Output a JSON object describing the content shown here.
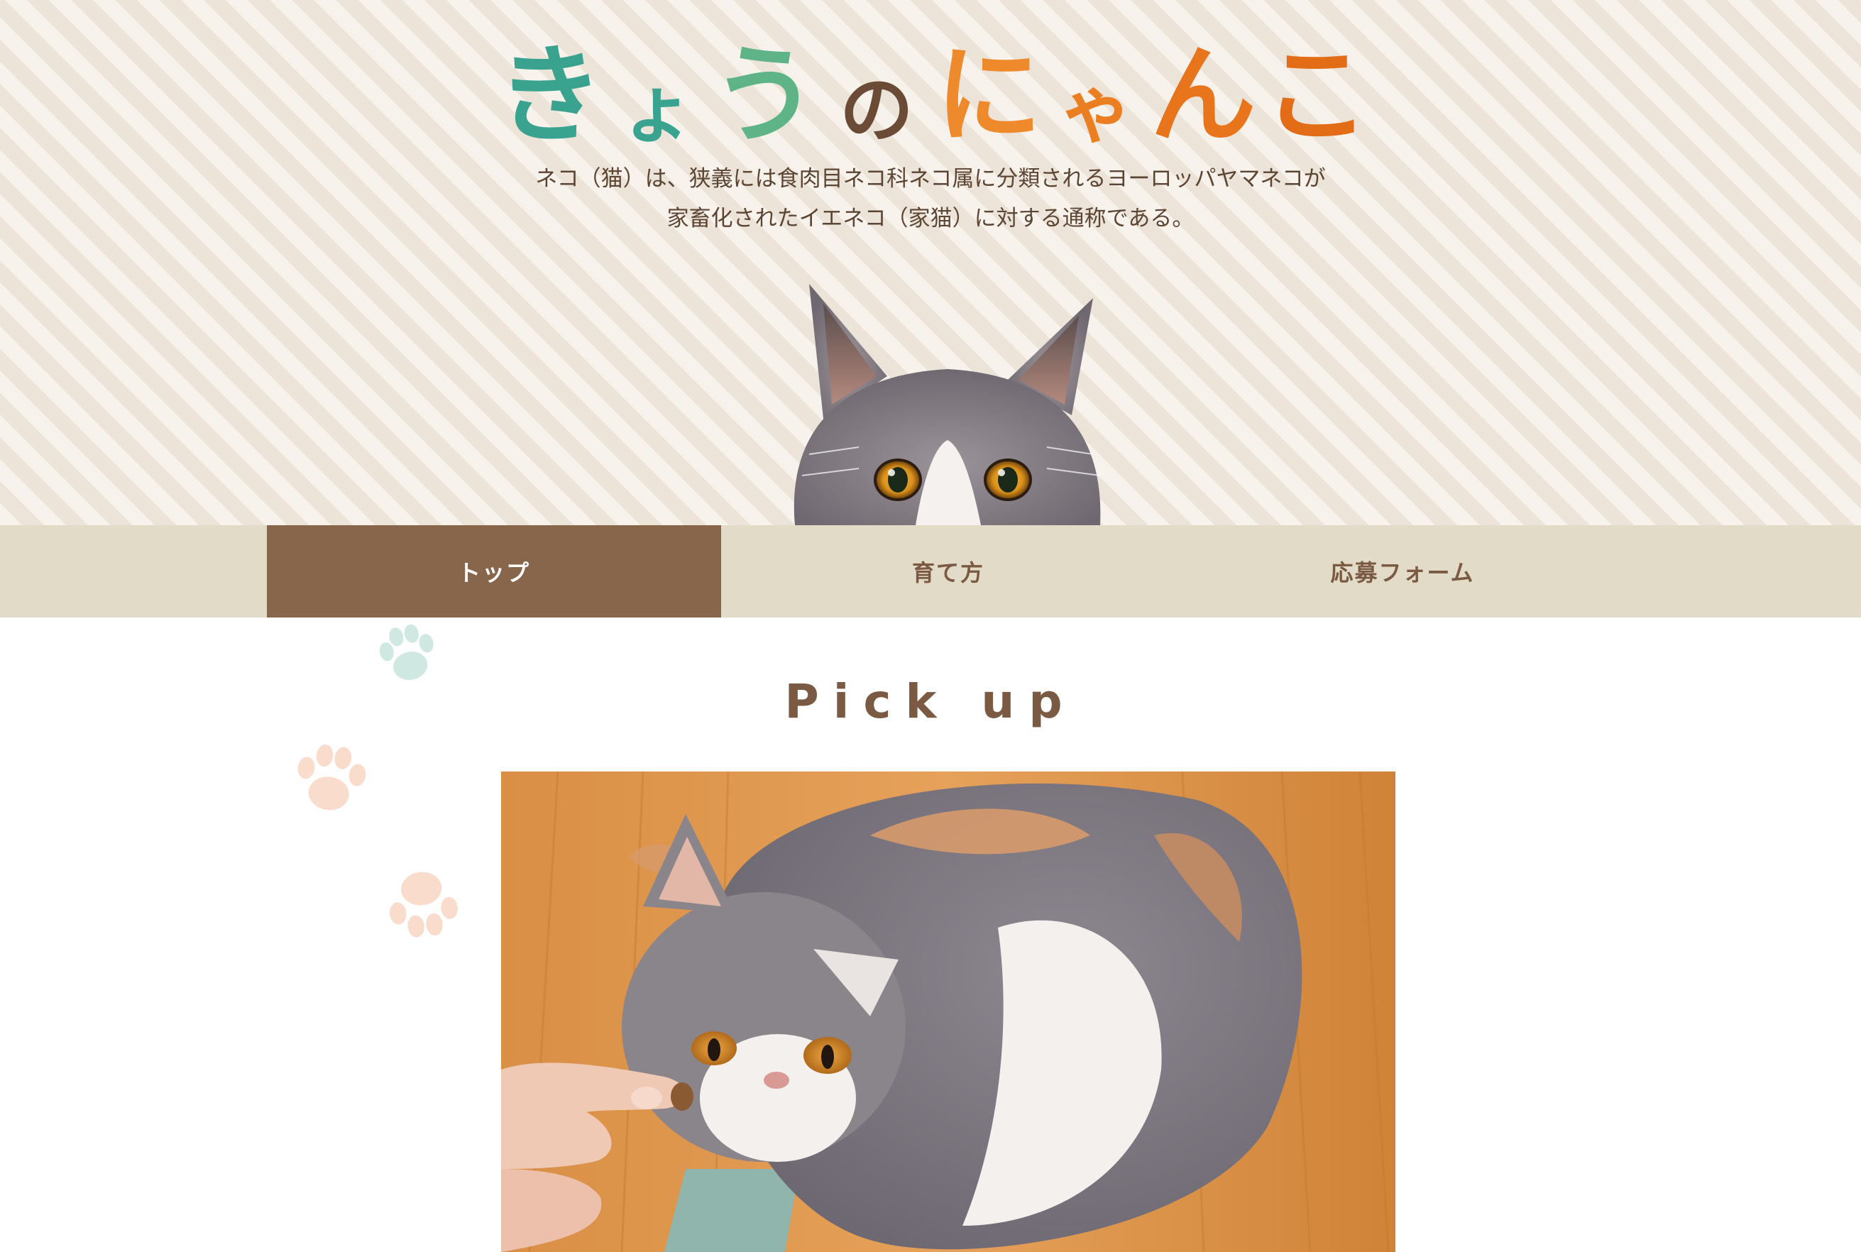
{
  "header": {
    "title_chars": [
      "き",
      "ょ",
      "う",
      "の",
      "に",
      "ゃ",
      "ん",
      "こ"
    ],
    "intro_line1": "ネコ（猫）は、狭義には食肉目ネコ科ネコ属に分類されるヨーロッパヤマネコが",
    "intro_line2": "家畜化されたイエネコ（家猫）に対する通称である。"
  },
  "nav": {
    "items": [
      {
        "label": "トップ"
      },
      {
        "label": "育て方"
      },
      {
        "label": "応募フォーム"
      }
    ],
    "active_index": 0
  },
  "main": {
    "pickup_heading": "Pick up"
  },
  "colors": {
    "title_teal": "#3aa38f",
    "title_green": "#6fb88a",
    "title_brown": "#6b4a36",
    "title_orange": "#e8741c",
    "nav_bg": "#e2dbc8",
    "nav_active_bg": "#87664c",
    "nav_text": "#7b5a43",
    "paw_mint": "#cfe9e2",
    "paw_peach": "#fadccc"
  },
  "icons": [
    "paw-print-icon"
  ]
}
